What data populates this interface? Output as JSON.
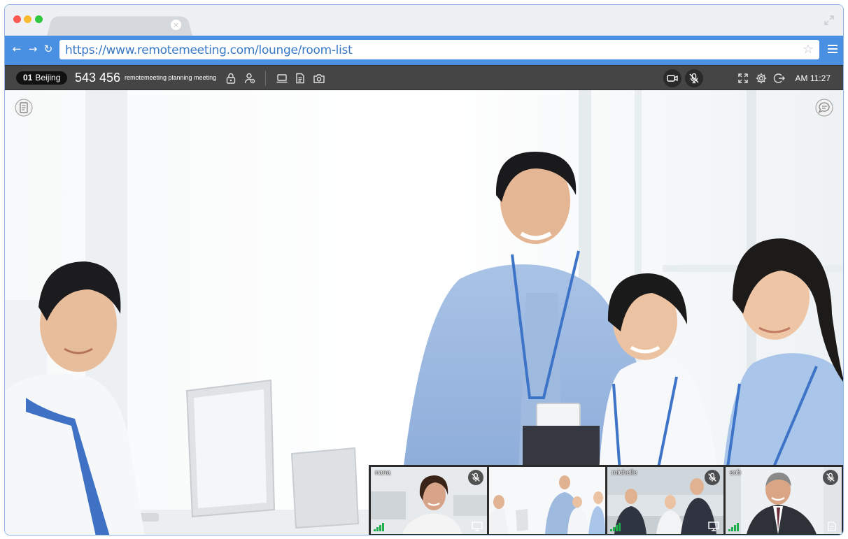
{
  "browser": {
    "url": "https://www.remotemeeting.com/lounge/room-list",
    "tab_close_glyph": "×",
    "back_glyph": "←",
    "forward_glyph": "→",
    "reload_glyph": "↻",
    "star_glyph": "☆",
    "icons": [
      "close-window-dot",
      "minimize-dot",
      "zoom-dot",
      "expand-icon",
      "star-icon",
      "menu-icon"
    ]
  },
  "toolbar": {
    "room_index": "01",
    "room_city": "Beijing",
    "room_number": "543 456",
    "room_title": "remotemeeting planning meeting",
    "clock": "AM 11:27",
    "icons": [
      "lock-icon",
      "user-settings-icon",
      "screen-share-icon",
      "document-icon",
      "camera-snapshot-icon",
      "video-camera-icon",
      "mic-muted-icon",
      "fullscreen-icon",
      "settings-gear-icon",
      "exit-icon"
    ]
  },
  "stage": {
    "icons": [
      "notes-icon",
      "chat-icon"
    ]
  },
  "participants": [
    {
      "name": "nana",
      "muted": true,
      "active": false
    },
    {
      "name": "",
      "muted": false,
      "active": true
    },
    {
      "name": "michelle",
      "muted": true,
      "active": false
    },
    {
      "name": "sob",
      "muted": true,
      "active": false
    }
  ],
  "colors": {
    "address_bar": "#4a90e2",
    "toolbar": "#454545",
    "active_speaker": "#1fb04c",
    "signal": "#1fb04c"
  }
}
